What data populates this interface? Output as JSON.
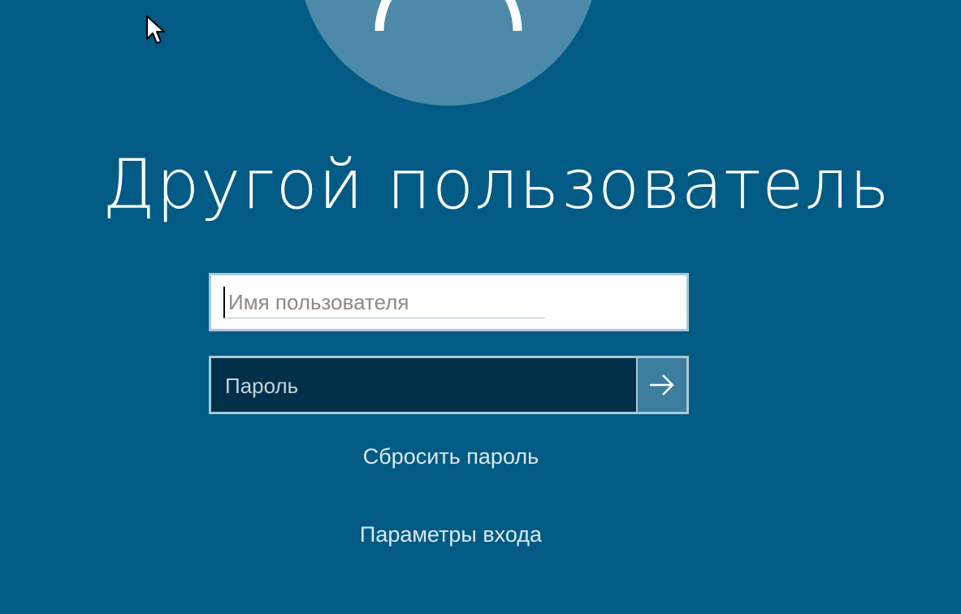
{
  "screen": {
    "background_color": "#015b84",
    "accent_color": "#4d8aaa"
  },
  "avatar": {
    "icon": "user-icon"
  },
  "title": "Другой пользователь",
  "username": {
    "value": "",
    "placeholder": "Имя пользователя"
  },
  "password": {
    "value": "",
    "placeholder": "Пароль",
    "submit_icon": "arrow-right-icon"
  },
  "links": {
    "reset_password": "Сбросить пароль",
    "sign_in_options": "Параметры входа"
  }
}
